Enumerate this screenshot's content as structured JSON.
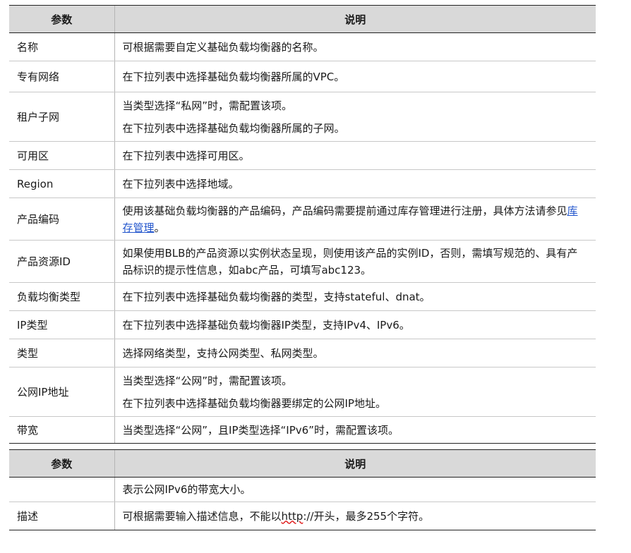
{
  "header": {
    "param": "参数",
    "desc": "说明"
  },
  "rows": [
    {
      "param": "名称",
      "lines": [
        "可根据需要自定义基础负载均衡器的名称。"
      ]
    },
    {
      "param": "专有网络",
      "lines": [
        "在下拉列表中选择基础负载均衡器所属的VPC。"
      ]
    },
    {
      "param": "租户子网",
      "lines": [
        "当类型选择“私网”时，需配置该项。",
        "在下拉列表中选择基础负载均衡器所属的子网。"
      ]
    },
    {
      "param": "可用区",
      "lines": [
        "在下拉列表中选择可用区。"
      ]
    },
    {
      "param": "Region",
      "lines": [
        "在下拉列表中选择地域。"
      ]
    },
    {
      "param": "产品编码",
      "text_before_link": "使用该基础负载均衡器的产品编码，产品编码需要提前通过库存管理进行注册，具体方法请参见",
      "link": "库存管理",
      "text_after_link": "。"
    },
    {
      "param": "产品资源ID",
      "lines": [
        "如果使用BLB的产品资源以实例状态呈现，则使用该产品的实例ID，否则，需填写规范的、具有产品标识的提示性信息，如abc产品，可填写abc123。"
      ]
    },
    {
      "param": "负载均衡类型",
      "lines": [
        "在下拉列表中选择基础负载均衡器的类型，支持stateful、dnat。"
      ]
    },
    {
      "param": "IP类型",
      "lines": [
        "在下拉列表中选择基础负载均衡器IP类型，支持IPv4、IPv6。"
      ]
    },
    {
      "param": "类型",
      "lines": [
        "选择网络类型，支持公网类型、私网类型。"
      ]
    },
    {
      "param": "公网IP地址",
      "lines": [
        "当类型选择“公网”时，需配置该项。",
        "在下拉列表中选择基础负载均衡器要绑定的公网IP地址。"
      ]
    },
    {
      "param": "带宽",
      "lines": [
        "当类型选择“公网”，且IP类型选择“IPv6”时，需配置该项。"
      ]
    }
  ],
  "rows2": [
    {
      "param": "",
      "lines": [
        "表示公网IPv6的带宽大小。"
      ]
    },
    {
      "param": "描述",
      "before": "可根据需要输入描述信息，不能以",
      "squiggle": "http",
      "after": "://开头，最多255个字符。"
    }
  ]
}
